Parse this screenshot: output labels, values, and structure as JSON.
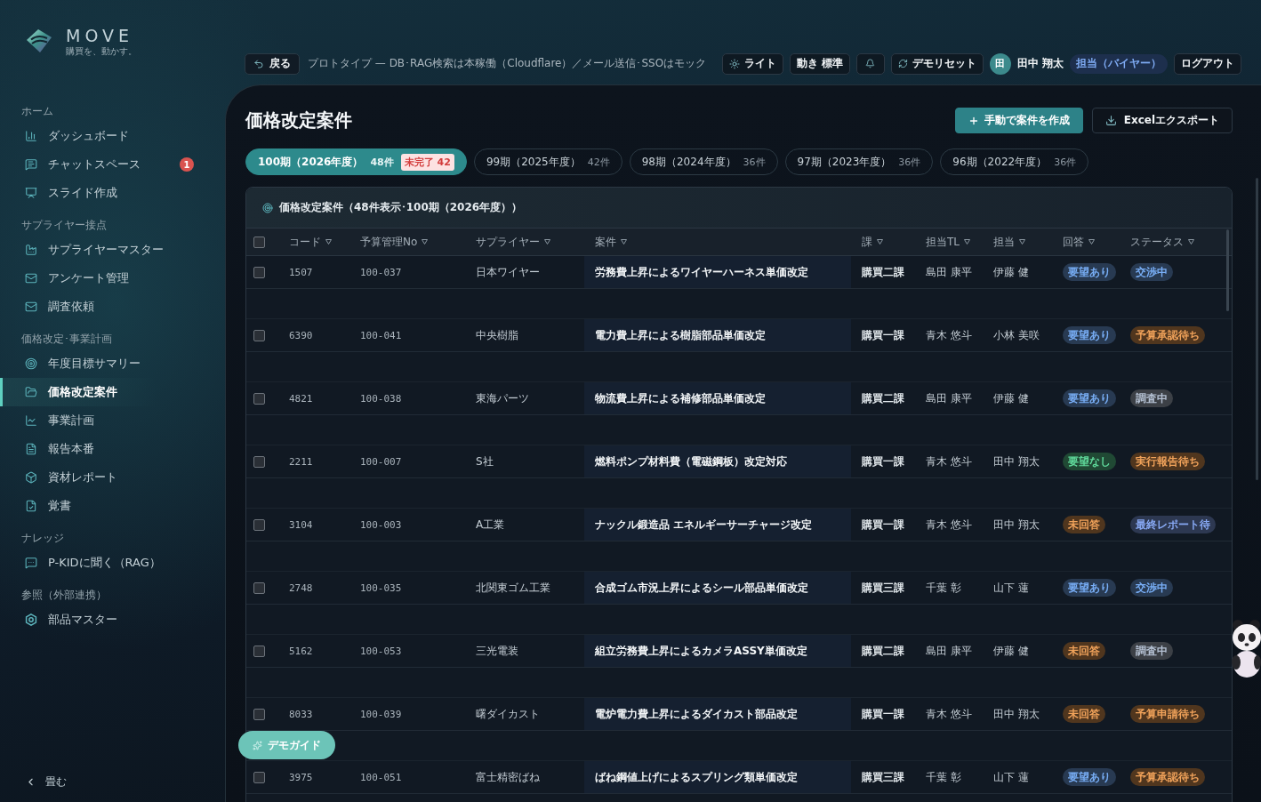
{
  "sidebar": {
    "logo": {
      "wordmark": "MOVE",
      "tagline": "購買を、動かす。"
    },
    "sections": [
      {
        "heading": "ホーム",
        "items": [
          {
            "label": "ダッシュボード",
            "selected": false
          },
          {
            "label": "チャットスペース",
            "selected": false,
            "badge": "1"
          },
          {
            "label": "スライド作成",
            "selected": false
          }
        ]
      },
      {
        "heading": "サプライヤー接点",
        "items": [
          {
            "label": "サプライヤーマスター",
            "selected": false
          },
          {
            "label": "アンケート管理",
            "selected": false
          },
          {
            "label": "調査依頼",
            "selected": false
          }
        ]
      },
      {
        "heading": "価格改定･事業計画",
        "items": [
          {
            "label": "年度目標サマリー",
            "selected": false
          },
          {
            "label": "価格改定案件",
            "selected": true
          },
          {
            "label": "事業計画",
            "selected": false
          },
          {
            "label": "報告本番",
            "selected": false
          },
          {
            "label": "資材レポート",
            "selected": false
          },
          {
            "label": "覚書",
            "selected": false
          }
        ]
      },
      {
        "heading": "ナレッジ",
        "items": [
          {
            "label": "P-KIDに聞く（RAG）",
            "selected": false
          }
        ]
      },
      {
        "heading": "参照（外部連携）",
        "items": [
          {
            "label": "部品マスター",
            "selected": false
          }
        ]
      }
    ],
    "collapse_button": "畳む"
  },
  "topbar": {
    "back_button": "戻る",
    "notice": "プロトタイプ — DB･RAG検索は本稼働（Cloudflare）／メール送信･SSOはモック",
    "theme_button": "ライト",
    "motion_button": "動き 標準",
    "reset_button": "デモリセット",
    "user": {
      "initial": "田",
      "name": "田中 翔太",
      "role": "担当（バイヤー）"
    },
    "logout_button": "ログアウト"
  },
  "page": {
    "title": "価格改定案件",
    "create_button": "手動で案件を作成",
    "export_button": "Excelエクスポート"
  },
  "period_tabs": [
    {
      "label": "100期（2026年度）",
      "count": "48件",
      "badge": "未完了 42",
      "selected": true
    },
    {
      "label": "99期（2025年度）",
      "count": "42件",
      "selected": false
    },
    {
      "label": "98期（2024年度）",
      "count": "36件",
      "selected": false
    },
    {
      "label": "97期（2023年度）",
      "count": "36件",
      "selected": false
    },
    {
      "label": "96期（2022年度）",
      "count": "36件",
      "selected": false
    }
  ],
  "cases_table": {
    "title": "価格改定案件（48件表示･100期（2026年度））",
    "select_all": {
      "checked": false
    },
    "columns": [
      "コード",
      "予算管理No",
      "サプライヤー",
      "案件",
      "課",
      "担当TL",
      "担当",
      "回答",
      "ステータス"
    ],
    "rows": [
      {
        "checked": false,
        "code": "1507",
        "budget_no": "100-037",
        "supplier": "日本ワイヤー",
        "title": "労務費上昇によるワイヤーハーネス単価改定",
        "section": "購買二課",
        "team_lead": "島田 康平",
        "owner": "伊藤 健",
        "answer": {
          "label": "要望あり",
          "color": "#283a52"
        },
        "status": {
          "label": "交渉中",
          "color": "#283a52"
        }
      },
      {
        "checked": false,
        "code": "6390",
        "budget_no": "100-041",
        "supplier": "中央樹脂",
        "title": "電力費上昇による樹脂部品単価改定",
        "section": "購買一課",
        "team_lead": "青木 悠斗",
        "owner": "小林 美咲",
        "answer": {
          "label": "要望あり",
          "color": "#283a52"
        },
        "status": {
          "label": "予算承認待ち",
          "color": "#50361e"
        }
      },
      {
        "checked": false,
        "code": "4821",
        "budget_no": "100-038",
        "supplier": "東海パーツ",
        "title": "物流費上昇による補修部品単価改定",
        "section": "購買二課",
        "team_lead": "島田 康平",
        "owner": "伊藤 健",
        "answer": {
          "label": "要望あり",
          "color": "#283a52"
        },
        "status": {
          "label": "調査中",
          "color": "#3c4046"
        }
      },
      {
        "checked": false,
        "code": "2211",
        "budget_no": "100-007",
        "supplier": "S社",
        "title": "燃料ポンプ材料費（電磁鋼板）改定対応",
        "section": "購買一課",
        "team_lead": "青木 悠斗",
        "owner": "田中 翔太",
        "answer": {
          "label": "要望なし",
          "color": "#204934"
        },
        "status": {
          "label": "実行報告待ち",
          "color": "#50361e"
        }
      },
      {
        "checked": false,
        "code": "3104",
        "budget_no": "100-003",
        "supplier": "A工業",
        "title": "ナックル鍛造品 エネルギーサーチャージ改定",
        "section": "購買一課",
        "team_lead": "青木 悠斗",
        "owner": "田中 翔太",
        "answer": {
          "label": "未回答",
          "color": "#50361e"
        },
        "status": {
          "label": "最終レポート待",
          "color": "#2d3851"
        }
      },
      {
        "checked": false,
        "code": "2748",
        "budget_no": "100-035",
        "supplier": "北関東ゴム工業",
        "title": "合成ゴム市況上昇によるシール部品単価改定",
        "section": "購買三課",
        "team_lead": "千葉 彰",
        "owner": "山下 蓮",
        "answer": {
          "label": "要望あり",
          "color": "#283a52"
        },
        "status": {
          "label": "交渉中",
          "color": "#283a52"
        }
      },
      {
        "checked": false,
        "code": "5162",
        "budget_no": "100-053",
        "supplier": "三光電装",
        "title": "組立労務費上昇によるカメラASSY単価改定",
        "section": "購買二課",
        "team_lead": "島田 康平",
        "owner": "伊藤 健",
        "answer": {
          "label": "未回答",
          "color": "#50361e"
        },
        "status": {
          "label": "調査中",
          "color": "#3c4046"
        }
      },
      {
        "checked": false,
        "code": "8033",
        "budget_no": "100-039",
        "supplier": "曙ダイカスト",
        "title": "電炉電力費上昇によるダイカスト部品改定",
        "section": "購買一課",
        "team_lead": "青木 悠斗",
        "owner": "田中 翔太",
        "answer": {
          "label": "未回答",
          "color": "#50361e"
        },
        "status": {
          "label": "予算申請待ち",
          "color": "#50361e"
        }
      },
      {
        "checked": false,
        "code": "3975",
        "budget_no": "100-051",
        "supplier": "富士精密ばね",
        "title": "ばね鋼値上げによるスプリング類単価改定",
        "section": "購買三課",
        "team_lead": "千葉 彰",
        "owner": "山下 蓮",
        "answer": {
          "label": "要望あり",
          "color": "#283a52"
        },
        "status": {
          "label": "予算承認待ち",
          "color": "#50361e"
        }
      }
    ]
  },
  "demo_guide_button": "デモガイド"
}
